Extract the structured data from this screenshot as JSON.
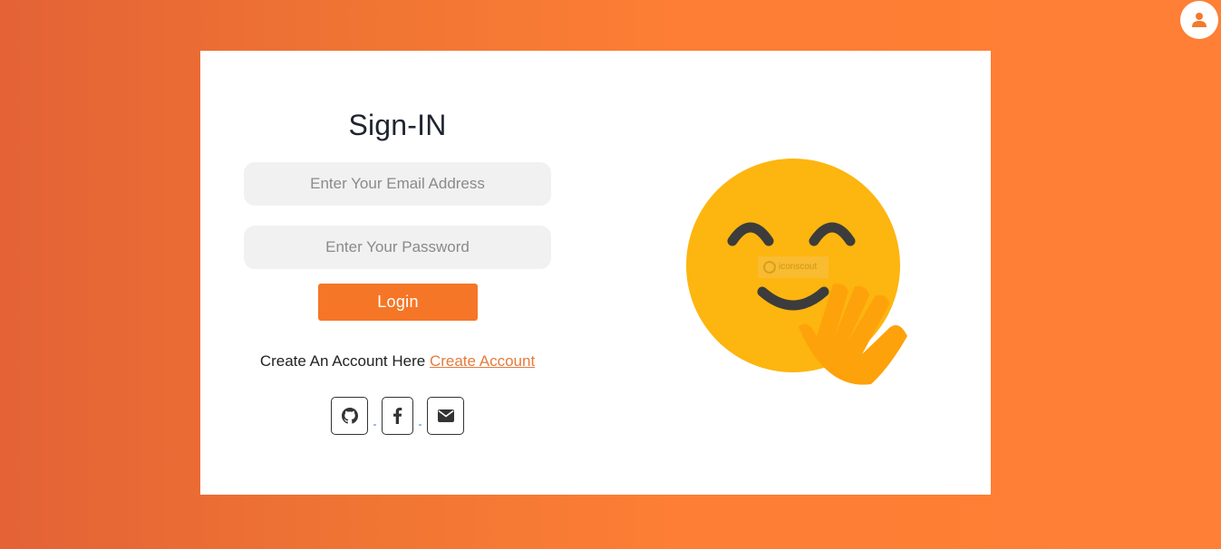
{
  "signin": {
    "title": "Sign-IN",
    "email_placeholder": "Enter Your Email Address",
    "password_placeholder": "Enter Your Password",
    "login_label": "Login",
    "create_prompt": "Create An Account Here",
    "create_link": "Create Account",
    "social": {
      "icons": [
        "github-icon",
        "facebook-icon",
        "envelope-icon"
      ],
      "separator": "-"
    }
  },
  "header": {
    "icon": "user-icon"
  },
  "illustration": {
    "subject": "waving-smiley-emoji",
    "watermark_text": "iconscout"
  },
  "colors": {
    "background_start": "#e46236",
    "background_end": "#fe7f35",
    "accent": "#f57626",
    "link": "#e57b3c",
    "emoji_face": "#fdb50f",
    "emoji_hand": "#fea20b"
  }
}
